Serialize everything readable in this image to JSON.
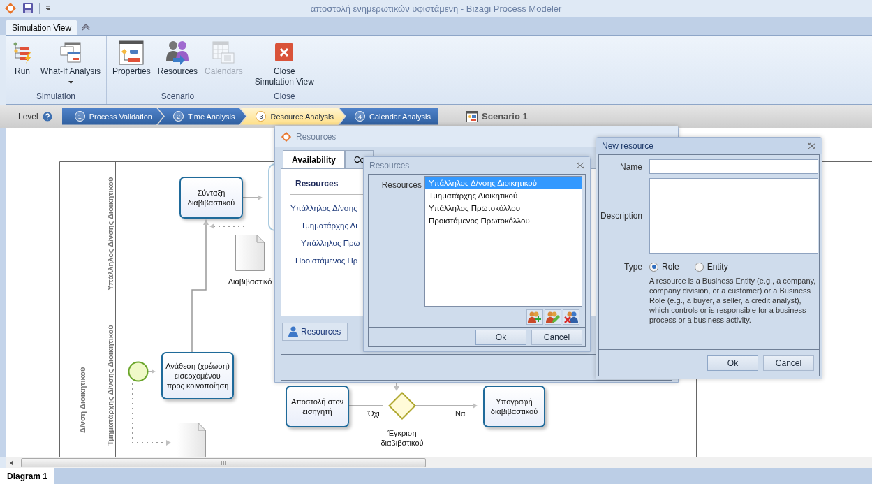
{
  "window": {
    "title": "αποστολή ενημερωτικών υφιστάμενη - Bizagi Process Modeler"
  },
  "ribbon": {
    "tabs": [
      {
        "label": "Simulation View",
        "selected": true
      }
    ],
    "groups": [
      {
        "label": "Simulation",
        "buttons": [
          {
            "kind": "run",
            "label": "Run",
            "disabled": false,
            "dropdown": false
          },
          {
            "kind": "whatif",
            "label": "What-If Analysis",
            "disabled": false,
            "dropdown": true
          }
        ]
      },
      {
        "label": "Scenario",
        "buttons": [
          {
            "kind": "properties",
            "label": "Properties",
            "disabled": false,
            "dropdown": false
          },
          {
            "kind": "resources",
            "label": "Resources",
            "disabled": false,
            "dropdown": false
          },
          {
            "kind": "calendars",
            "label": "Calendars",
            "disabled": true,
            "dropdown": false
          }
        ]
      },
      {
        "label": "Close",
        "buttons": [
          {
            "kind": "close",
            "label": "Close\nSimulation View",
            "disabled": false,
            "dropdown": false
          }
        ]
      }
    ]
  },
  "level_bar": {
    "label": "Level",
    "steps": [
      {
        "number": "1",
        "label": "Process Validation",
        "selected": false
      },
      {
        "number": "2",
        "label": "Time Analysis",
        "selected": false
      },
      {
        "number": "3",
        "label": "Resource Analysis",
        "selected": true
      },
      {
        "number": "4",
        "label": "Calendar Analysis",
        "selected": false
      }
    ],
    "scenario": "Scenario 1"
  },
  "diagram": {
    "pool": {
      "label": "Δ/νση Διοικητικού"
    },
    "lanes": [
      {
        "label": "Υπάλληλος Δ/νσης Διοικητικού"
      },
      {
        "label": "Τμηματάρχης Δ/νσης Διοικητικού"
      }
    ],
    "nodes": [
      {
        "kind": "task",
        "label": "Σύνταξη διαβιβαστικού"
      },
      {
        "kind": "group"
      },
      {
        "kind": "document",
        "label": "Διαβιβαστικό"
      },
      {
        "kind": "start"
      },
      {
        "kind": "task",
        "label": "Ανάθεση (χρέωση) εισερχομένου προς κοινοποίηση"
      },
      {
        "kind": "document"
      },
      {
        "kind": "task",
        "label": "Αποστολή στον εισηγητή"
      },
      {
        "kind": "gateway",
        "label": "Έγκριση διαβιβστικού"
      },
      {
        "kind": "task",
        "label": "Υπογραφή διαβιβαστικού"
      }
    ],
    "edge_labels": [
      "Όχι",
      "Ναι"
    ]
  },
  "resources_dialog": {
    "title": "Resources",
    "tabs": [
      {
        "label": "Availability",
        "selected": true
      },
      {
        "label": "Co",
        "selected": false
      }
    ],
    "column_header": "Resources",
    "resources": [
      "Υπάλληλος Δ/νσης",
      "Τμηματάρχης Δι",
      "Υπάλληλος Πρω",
      "Προιστάμενος Πρ"
    ],
    "resources_button": "Resources"
  },
  "resource_picker": {
    "title": "Resources",
    "label": "Resources",
    "items": [
      {
        "label": "Υπάλληλος Δ/νσης Διοικητικού",
        "selected": true
      },
      {
        "label": "Τμηματάρχης Διοικητικού",
        "selected": false
      },
      {
        "label": "Υπάλληλος Πρωτοκόλλου",
        "selected": false
      },
      {
        "label": "Προιστάμενος Πρωτοκόλλου",
        "selected": false
      }
    ],
    "buttons": [
      "Ok",
      "Cancel"
    ]
  },
  "new_resource": {
    "title": "New resource",
    "name_label": "Name",
    "description_label": "Description",
    "type_label": "Type",
    "types": [
      {
        "label": "Role",
        "selected": true
      },
      {
        "label": "Entity",
        "selected": false
      }
    ],
    "help": "A resource is a Business Entity (e.g., a company, company division, or a customer) or a Business Role (e.g., a buyer, a seller, a credit analyst), which controls or is responsible for a business process or a business activity.",
    "buttons": [
      "Ok",
      "Cancel"
    ]
  },
  "bottom_tabs": [
    {
      "label": "Diagram 1",
      "selected": true
    }
  ]
}
